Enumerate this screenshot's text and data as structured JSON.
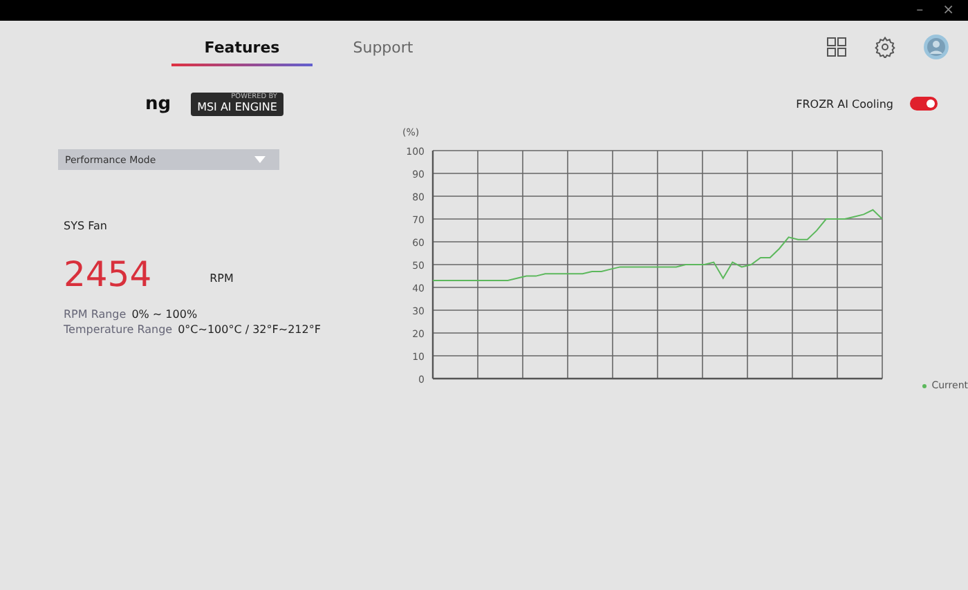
{
  "window": {
    "controls": [
      "–",
      "×"
    ]
  },
  "tabs": [
    {
      "label": "Features",
      "selected": true
    },
    {
      "label": "Support",
      "selected": false
    }
  ],
  "header": {
    "title": "ng",
    "badge_caption": "POWERED BY",
    "badge": "MSI AI ENGINE",
    "toggle": {
      "label": "FROZR AI Cooling",
      "on": true
    }
  },
  "mode_select": {
    "value": "Performance Mode"
  },
  "fan": {
    "name": "SYS Fan",
    "rpm": "2454",
    "unit": "RPM",
    "details": [
      {
        "label": "RPM Range",
        "value": "0% ~ 100%"
      },
      {
        "label": "Temperature Range",
        "value": "0°C~100°C / 32°F~212°F"
      }
    ]
  },
  "chart": {
    "chart_data": {
      "type": "line",
      "grid": true,
      "ylabel": "(%)",
      "ylim": [
        0,
        100
      ],
      "yticks": [
        0,
        10,
        20,
        30,
        40,
        50,
        60,
        70,
        80,
        90,
        100
      ],
      "series": [
        {
          "name": "Current",
          "color": "#5cb85c",
          "values": [
            43,
            43,
            43,
            43,
            43,
            43,
            43,
            43,
            43,
            44,
            45,
            45,
            46,
            46,
            46,
            46,
            46,
            47,
            47,
            48,
            49,
            49,
            49,
            49,
            49,
            49,
            49,
            50,
            50,
            50,
            51,
            44,
            51,
            49,
            50,
            53,
            53,
            57,
            62,
            61,
            61,
            65,
            70,
            70,
            70,
            71,
            72,
            74,
            70
          ]
        }
      ]
    }
  }
}
